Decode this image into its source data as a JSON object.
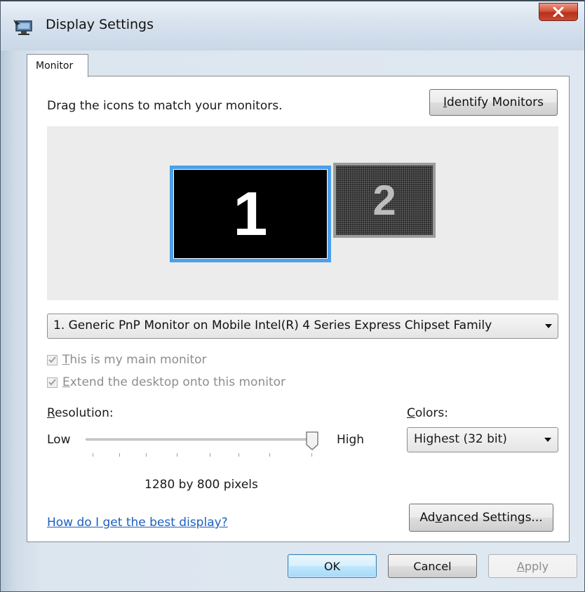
{
  "window": {
    "title": "Display Settings",
    "close_icon": "close-x-icon",
    "app_icon": "display-settings-icon"
  },
  "tabs": [
    {
      "label": "Monitor",
      "selected": true
    }
  ],
  "instructions": "Drag the icons to match your monitors.",
  "identify_button": {
    "prefix": "",
    "accel": "I",
    "suffix": "dentify Monitors"
  },
  "monitors": [
    {
      "number": "1",
      "selected": true
    },
    {
      "number": "2",
      "selected": false
    }
  ],
  "monitor_select": {
    "value": "1. Generic PnP Monitor on Mobile Intel(R) 4 Series Express Chipset Family"
  },
  "checkboxes": [
    {
      "accel": "T",
      "rest": "his is my main monitor",
      "checked": true,
      "disabled": true
    },
    {
      "accel": "E",
      "rest": "xtend the desktop onto this monitor",
      "checked": true,
      "disabled": true
    }
  ],
  "resolution": {
    "label_accel": "R",
    "label_rest": "esolution:",
    "low": "Low",
    "high": "High",
    "level": 1.0,
    "value_text": "1280 by 800 pixels"
  },
  "colors": {
    "label_accel": "C",
    "label_rest": "olors:",
    "value": "Highest (32 bit)"
  },
  "help_link": "How do I get the best display?",
  "advanced_button": {
    "prefix": "Ad",
    "accel": "v",
    "suffix": "anced Settings..."
  },
  "buttons": {
    "ok": "OK",
    "cancel": "Cancel",
    "apply_accel": "A",
    "apply_rest": "pply"
  },
  "colors_palette": {
    "selected_monitor_border": "#4aa0ea",
    "link": "#1d5fc1",
    "close_button": "#c84a33"
  }
}
